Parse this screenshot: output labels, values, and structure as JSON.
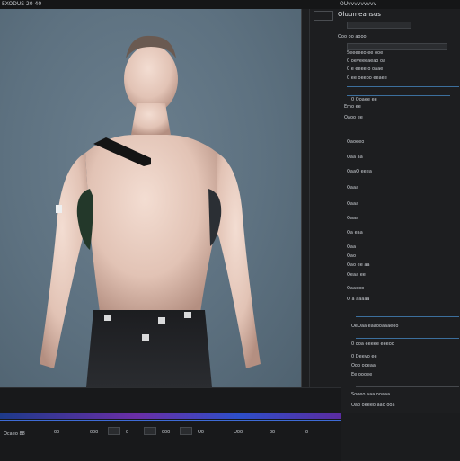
{
  "app": {
    "topbar_left": "EXODUS 20 40",
    "topbar_right": "OUvvvvvvvvv"
  },
  "sidebar": {
    "tab_label": "",
    "title": "Oluumeansus",
    "rows": [
      "Ooo oo aooo",
      "Seeeeeo ee ooe",
      "0 oeveeeaeao oa",
      "0 e eeee o oaae",
      "0 ee oeeoo eeaee",
      "0 Ooaee ee",
      "Emo ee",
      "Oaoo ee",
      "Oaoeeo",
      "Oaa  aa",
      "OaaO eeea",
      "Oaaa",
      "Oaaa",
      "Oaaa",
      "Oa eaa",
      "Oaa",
      "Oao",
      "Oao ee aa",
      "Oeaa ee",
      "Oaaooo",
      "O a  aaaaa",
      "OeOaa eaaooaaaeoo",
      "0 ooa eeeee eeeoo",
      "0 Deevo ee",
      "Ooo ooeaa",
      "Ee oooee",
      "Sooeo aaa ooaaa",
      "Oao oeeeo aao ooa"
    ]
  },
  "timeline": {
    "left_label": "Ocaeo 88",
    "labels": [
      "oo",
      "ooo",
      "o",
      "ooo",
      "Oo",
      "Ooo",
      "oo",
      "o"
    ]
  },
  "viewport": {
    "background": "#5f7483",
    "model": "bare-chested 3D male figure wearing dark shorts"
  }
}
